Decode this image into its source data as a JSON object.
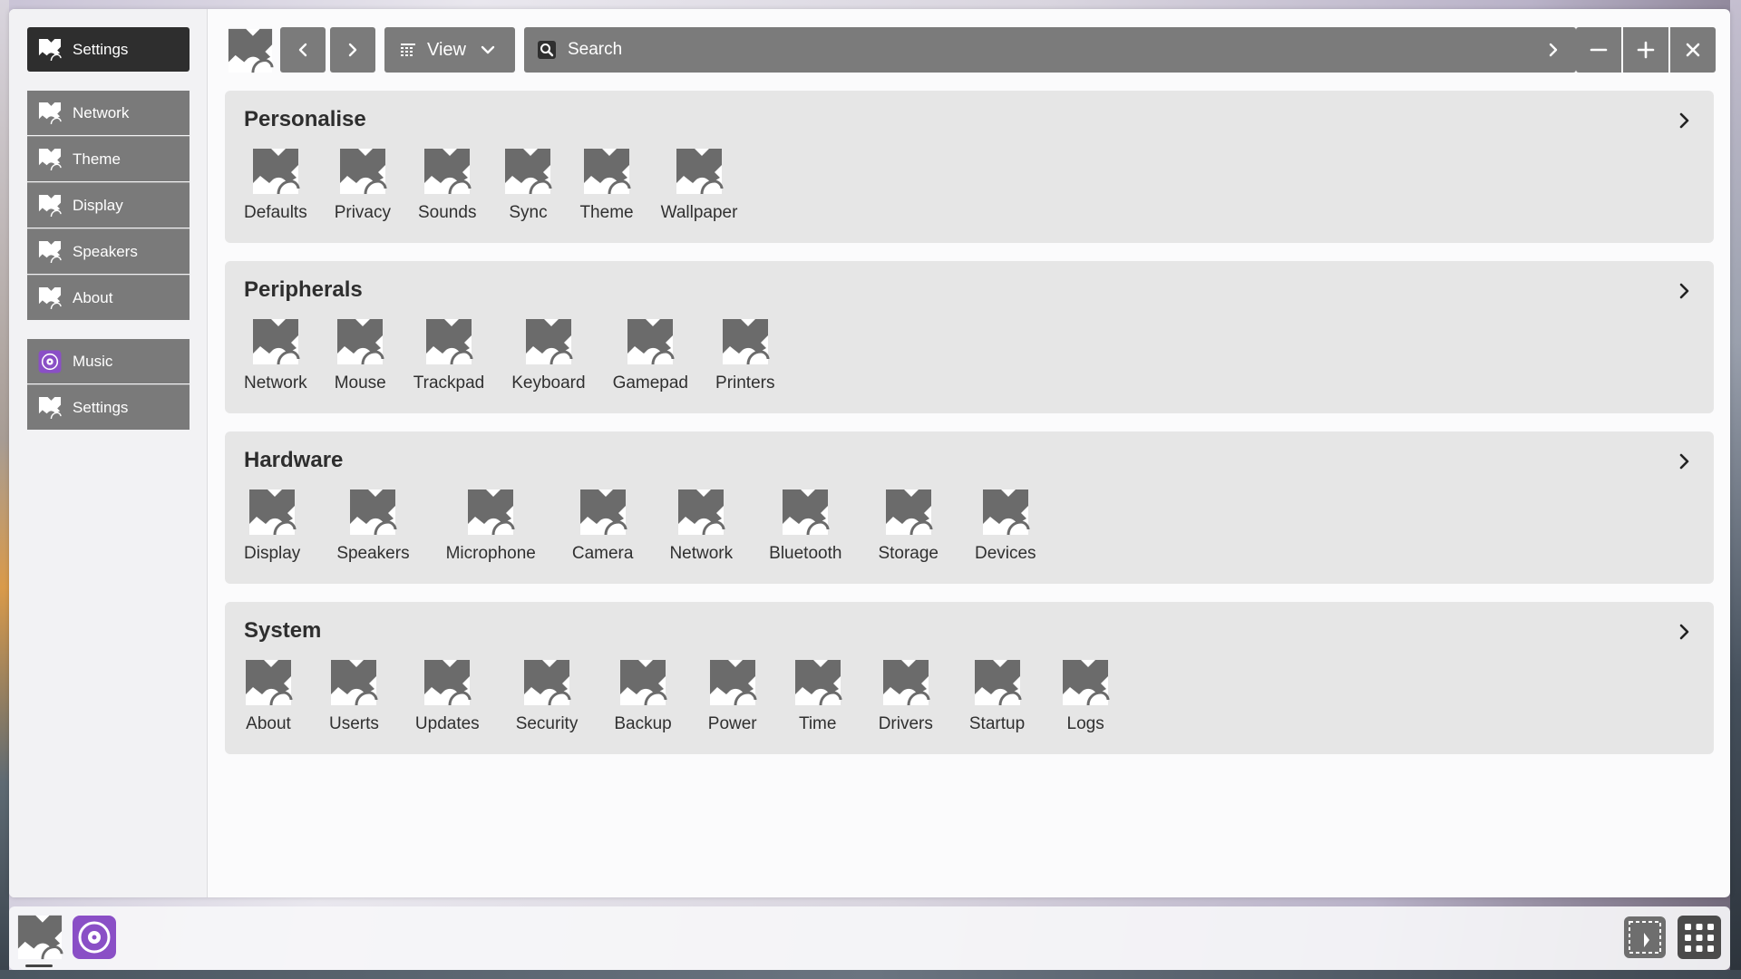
{
  "sidebar": {
    "title_button": {
      "label": "Settings",
      "icon": "settings-app-icon"
    },
    "group1": [
      {
        "label": "Network",
        "icon": "settings-app-icon"
      },
      {
        "label": "Theme",
        "icon": "settings-app-icon"
      },
      {
        "label": "Display",
        "icon": "settings-app-icon"
      },
      {
        "label": "Speakers",
        "icon": "settings-app-icon"
      },
      {
        "label": "About",
        "icon": "settings-app-icon"
      }
    ],
    "group2": [
      {
        "label": "Music",
        "icon": "music-app-icon"
      },
      {
        "label": "Settings",
        "icon": "settings-app-icon"
      }
    ]
  },
  "toolbar": {
    "view_label": "View",
    "search_placeholder": "Search"
  },
  "sections": [
    {
      "title": "Personalise",
      "items": [
        "Defaults",
        "Privacy",
        "Sounds",
        "Sync",
        "Theme",
        "Wallpaper"
      ]
    },
    {
      "title": "Peripherals",
      "items": [
        "Network",
        "Mouse",
        "Trackpad",
        "Keyboard",
        "Gamepad",
        "Printers"
      ]
    },
    {
      "title": "Hardware",
      "items": [
        "Display",
        "Speakers",
        "Microphone",
        "Camera",
        "Network",
        "Bluetooth",
        "Storage",
        "Devices"
      ]
    },
    {
      "title": "System",
      "items": [
        "About",
        "Userts",
        "Updates",
        "Security",
        "Backup",
        "Power",
        "Time",
        "Drivers",
        "Startup",
        "Logs"
      ]
    }
  ],
  "taskbar": {
    "items": [
      "settings-app-icon",
      "music-app-icon"
    ],
    "right": [
      "widget-icon",
      "app-grid-icon"
    ]
  },
  "colors": {
    "accent": "#7b7b7b",
    "active": "#2e2e2e",
    "music_purple": "#8a4fc6"
  }
}
